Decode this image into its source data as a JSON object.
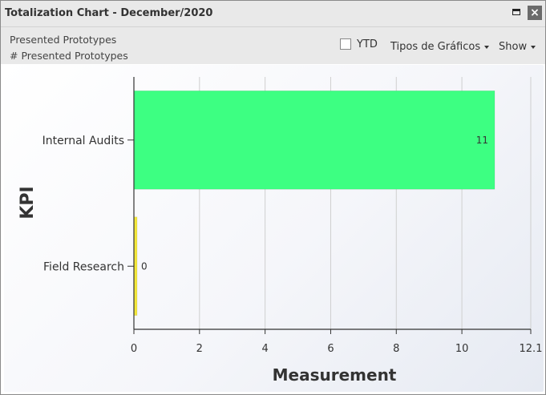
{
  "window": {
    "title": "Totalization Chart - December/2020"
  },
  "toolbar": {
    "subtitle_1": "Presented Prototypes",
    "subtitle_2": "# Presented Prototypes",
    "ytd_label": "YTD",
    "ytd_checked": false,
    "chart_types_label": "Tipos de Gráficos",
    "show_label": "Show"
  },
  "icons": {
    "maximize": "maximize-icon",
    "close": "close-icon"
  },
  "chart_data": {
    "type": "bar",
    "orientation": "horizontal",
    "categories": [
      "Internal Audits",
      "Field Research"
    ],
    "values": [
      11,
      0
    ],
    "bar_colors": [
      "#3dff82",
      "#f4e83a"
    ],
    "data_labels": [
      "11",
      "0"
    ],
    "xlabel": "Measurement",
    "ylabel": "KPI",
    "xlim": [
      0,
      12.1
    ],
    "x_ticks": [
      "0",
      "2",
      "4",
      "6",
      "8",
      "10",
      "12.1"
    ],
    "grid": "vertical",
    "legend": "none"
  }
}
